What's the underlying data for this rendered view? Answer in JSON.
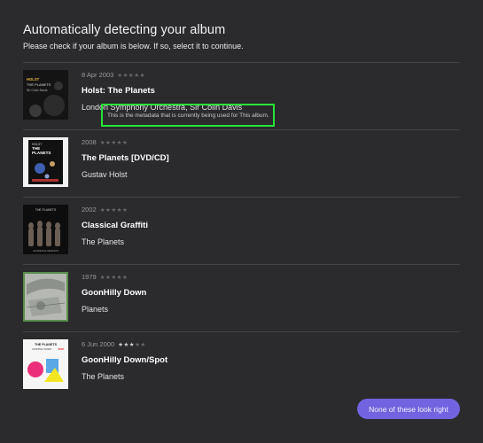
{
  "header": {
    "title": "Automatically detecting your album",
    "subtitle": "Please check if your album is below. If so, select it to continue."
  },
  "results": [
    {
      "date": "8 Apr 2003",
      "rating": 0,
      "album": "Holst: The Planets",
      "artist": "London Symphony Orchestra, Sir Colin Davis",
      "note": "This is the metadata that is currently being used for This album.",
      "art_text": [
        "HOLST",
        "THE PLANETS",
        "Sir Colin Davis"
      ]
    },
    {
      "date": "2008",
      "rating": 0,
      "album": "The Planets [DVD/CD]",
      "artist": "Gustav Holst",
      "art_text": [
        "HOLST",
        "THE",
        "PLANETS"
      ]
    },
    {
      "date": "2002",
      "rating": 0,
      "album": "Classical Graffiti",
      "artist": "The Planets",
      "art_text": [
        "THE PLANETS",
        "CLASSICAL GRAFFITI"
      ]
    },
    {
      "date": "1979",
      "rating": 0,
      "album": "GoonHilly Down",
      "artist": "Planets"
    },
    {
      "date": "6 Jun 2000",
      "rating": 3,
      "album": "GoonHilly Down/Spot",
      "artist": "The Planets",
      "art_text": [
        "THE PLANETS",
        "GOONHILLY DOWN",
        "SPOT"
      ]
    }
  ],
  "footer": {
    "none_label": "None of these look right"
  },
  "colors": {
    "background": "#2b2a2d",
    "accent": "#7264e0",
    "highlight": "#27e53a"
  }
}
